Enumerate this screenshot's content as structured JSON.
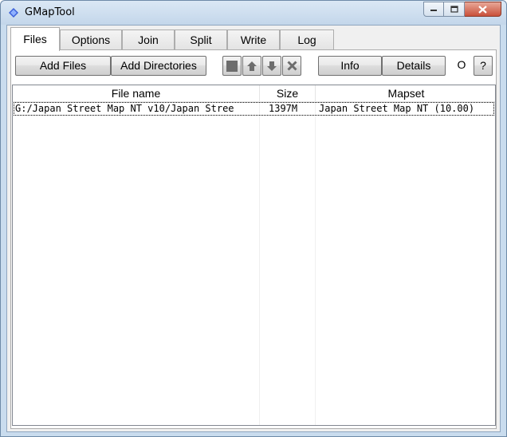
{
  "window": {
    "title": "GMapTool",
    "minimize_icon": "minimize-icon",
    "maximize_icon": "maximize-icon",
    "close_icon": "close-icon"
  },
  "tabs": [
    {
      "label": "Files",
      "active": true
    },
    {
      "label": "Options"
    },
    {
      "label": "Join"
    },
    {
      "label": "Split"
    },
    {
      "label": "Write"
    },
    {
      "label": "Log"
    }
  ],
  "toolbar": {
    "add_files": "Add Files",
    "add_directories": "Add Directories",
    "stop_icon": "stop-icon",
    "up_icon": "arrow-up-icon",
    "down_icon": "arrow-down-icon",
    "remove_icon": "remove-x-icon",
    "info": "Info",
    "details": "Details",
    "circle_label": "O",
    "help_label": "?"
  },
  "table": {
    "columns": [
      "File name",
      "Size",
      "Mapset"
    ],
    "rows": [
      {
        "file_name": "G:/Japan Street Map NT v10/Japan Stree",
        "size": "1397M",
        "mapset": "Japan Street Map NT (10.00)"
      }
    ]
  }
}
